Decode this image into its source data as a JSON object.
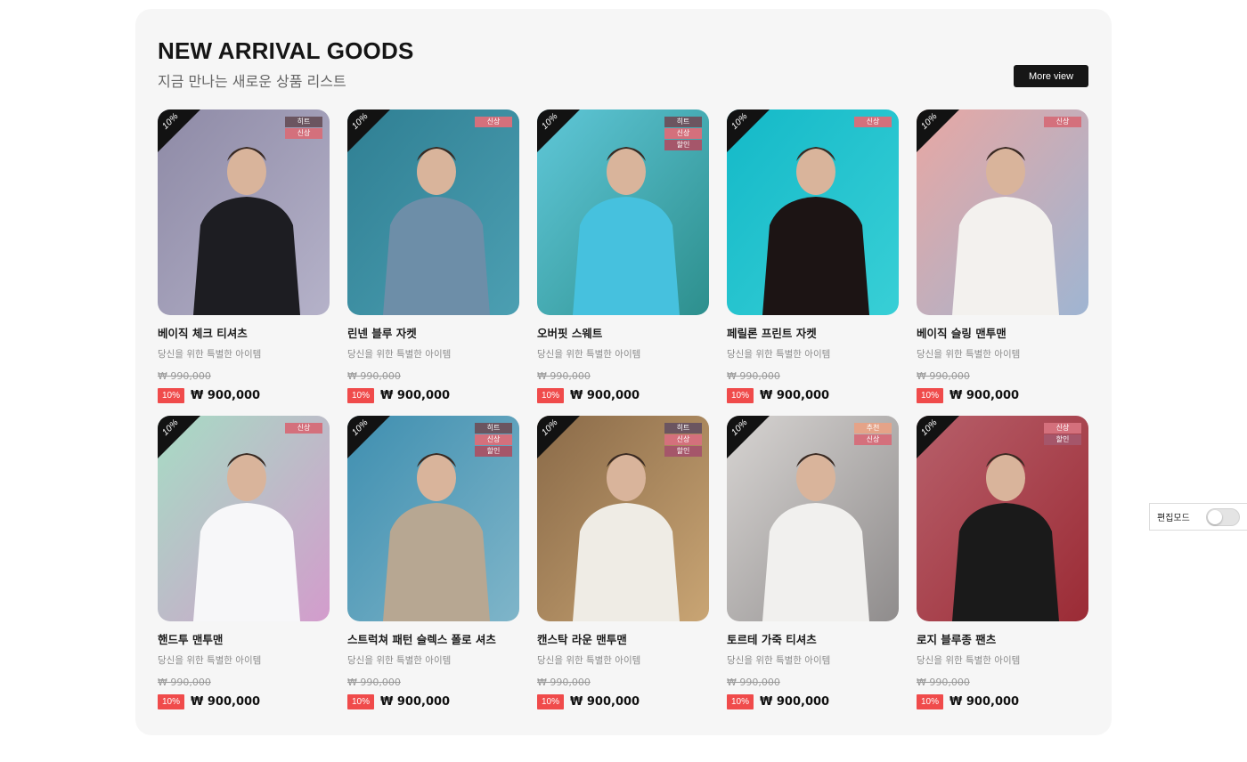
{
  "section": {
    "title": "NEW ARRIVAL GOODS",
    "subtitle": "지금 만나는 새로운 상품 리스트",
    "more_label": "More view"
  },
  "products": [
    {
      "name": "베이직 체크 티셔츠",
      "desc": "당신을 위한 특별한 아이템",
      "orig": "₩ 990,000",
      "disc": "10%",
      "price": "₩ 900,000",
      "corner": "10%",
      "badges": [
        "히트",
        "신상"
      ],
      "bg": [
        "#8e8aa6",
        "#b5b2c9"
      ],
      "shirt": "#1d1d22"
    },
    {
      "name": "린넨 블루 자켓",
      "desc": "당신을 위한 특별한 아이템",
      "orig": "₩ 990,000",
      "disc": "10%",
      "price": "₩ 900,000",
      "corner": "10%",
      "badges": [
        "신상"
      ],
      "bg": [
        "#2f7f93",
        "#4c9fb2"
      ],
      "shirt": "#6d8ea8"
    },
    {
      "name": "오버핏 스웨트",
      "desc": "당신을 위한 특별한 아이템",
      "orig": "₩ 990,000",
      "disc": "10%",
      "price": "₩ 900,000",
      "corner": "10%",
      "badges": [
        "히트",
        "신상",
        "할인"
      ],
      "bg": [
        "#5fc7d8",
        "#2d8f8d"
      ],
      "shirt": "#46c1de"
    },
    {
      "name": "페릴론 프린트 자켓",
      "desc": "당신을 위한 특별한 아이템",
      "orig": "₩ 990,000",
      "disc": "10%",
      "price": "₩ 900,000",
      "corner": "10%",
      "badges": [
        "신상"
      ],
      "bg": [
        "#14b9c8",
        "#38cfd6"
      ],
      "shirt": "#1c1414"
    },
    {
      "name": "베이직 슬링 맨투맨",
      "desc": "당신을 위한 특별한 아이템",
      "orig": "₩ 990,000",
      "disc": "10%",
      "price": "₩ 900,000",
      "corner": "10%",
      "badges": [
        "신상"
      ],
      "bg": [
        "#e8a7a3",
        "#9fb5d2"
      ],
      "shirt": "#f3f1ee"
    },
    {
      "name": "핸드투 맨투맨",
      "desc": "당신을 위한 특별한 아이템",
      "orig": "₩ 990,000",
      "disc": "10%",
      "price": "₩ 900,000",
      "corner": "10%",
      "badges": [
        "신상"
      ],
      "bg": [
        "#a6dcc4",
        "#d39ccc"
      ],
      "shirt": "#f7f7f9"
    },
    {
      "name": "스트럭쳐 패턴 슬렉스 폴로 셔츠",
      "desc": "당신을 위한 특별한 아이템",
      "orig": "₩ 990,000",
      "disc": "10%",
      "price": "₩ 900,000",
      "corner": "10%",
      "badges": [
        "히트",
        "신상",
        "할인"
      ],
      "bg": [
        "#3f8fb0",
        "#7fb5c9"
      ],
      "shirt": "#b7a792"
    },
    {
      "name": "캔스탁 라운 맨투맨",
      "desc": "당신을 위한 특별한 아이템",
      "orig": "₩ 990,000",
      "disc": "10%",
      "price": "₩ 900,000",
      "corner": "10%",
      "badges": [
        "히트",
        "신상",
        "할인"
      ],
      "bg": [
        "#8a6a48",
        "#c9a574"
      ],
      "shirt": "#efece5"
    },
    {
      "name": "토르테 가죽 티셔츠",
      "desc": "당신을 위한 특별한 아이템",
      "orig": "₩ 990,000",
      "disc": "10%",
      "price": "₩ 900,000",
      "corner": "10%",
      "badges": [
        "추천",
        "신상"
      ],
      "bg": [
        "#d7d4d2",
        "#8f8c8c"
      ],
      "shirt": "#f1f0ee"
    },
    {
      "name": "로지 블루종 팬츠",
      "desc": "당신을 위한 특별한 아이템",
      "orig": "₩ 990,000",
      "disc": "10%",
      "price": "₩ 900,000",
      "corner": "10%",
      "badges": [
        "신상",
        "할인"
      ],
      "bg": [
        "#b75f6a",
        "#9b2b35"
      ],
      "shirt": "#1a1a1a"
    }
  ],
  "edit_mode": {
    "label": "편집모드",
    "enabled": false
  },
  "badge_colors": {
    "히트": "#6b5560",
    "신상": "#d4707c",
    "할인": "#a5566a",
    "추천": "#e5a388"
  }
}
